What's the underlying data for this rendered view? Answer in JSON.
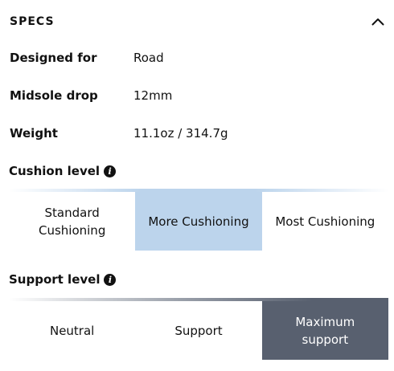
{
  "specs": {
    "title": "SPECS",
    "toggle_icon": "chevron-up-icon",
    "rows": [
      {
        "label": "Designed for",
        "value": "Road"
      },
      {
        "label": "Midsole drop",
        "value": "12mm"
      },
      {
        "label": "Weight",
        "value": "11.1oz / 314.7g"
      }
    ]
  },
  "cushion": {
    "heading": "Cushion level",
    "info_icon": "info-icon",
    "options": [
      "Standard\nCushioning",
      "More Cushioning",
      "Most Cushioning"
    ],
    "selected": "More Cushioning",
    "selected_color": "#bcd4ec"
  },
  "support": {
    "heading": "Support level",
    "info_icon": "info-icon",
    "options": [
      "Neutral",
      "Support",
      "Maximum\nsupport"
    ],
    "selected": "Maximum support",
    "selected_color": "#58606f"
  },
  "info_glyph": "i"
}
